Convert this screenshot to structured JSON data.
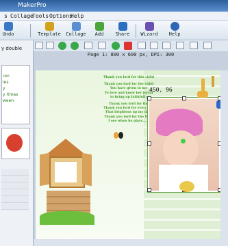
{
  "window": {
    "title": "MakerPro"
  },
  "menu": [
    "s",
    "Collage",
    "Tools",
    "Options",
    "Help"
  ],
  "toolbar": [
    {
      "label": "Undo",
      "icon": "undo-icon",
      "color": "#3a78c5"
    },
    {
      "label": "Template",
      "icon": "template-icon",
      "color": "#d3a21c"
    },
    {
      "label": "Collage",
      "icon": "collage-icon",
      "color": "#5a8fd0"
    },
    {
      "label": "Add",
      "icon": "add-icon",
      "color": "#4aa53a"
    },
    {
      "label": "Share",
      "icon": "share-icon",
      "color": "#2b6fc1"
    },
    {
      "label": "Wizard",
      "icon": "wizard-icon",
      "color": "#6a4fb0"
    },
    {
      "label": "Help",
      "icon": "help-icon",
      "color": "#2c66b4"
    }
  ],
  "page_info": "Page 1: 800 x 600 px, DPI: 300",
  "left_panel": {
    "items": [
      "y double",
      "ren",
      "ies",
      "y",
      "y Xmas",
      "ween"
    ]
  },
  "coords": "450, 96",
  "poem": [
    "Thank you lord for this child",
    "Thank you lord for the child",
    "You have given to me",
    "To love and know her joyful",
    "to bring up faithfully",
    "Thank you lord for the",
    "Thank you lord for every day",
    "That brightens up my days",
    "Thank you lord for the little",
    "I see when he plays......"
  ],
  "colors": {
    "titlebar": "#2d5f9a",
    "accent": "#3b9a1f"
  }
}
